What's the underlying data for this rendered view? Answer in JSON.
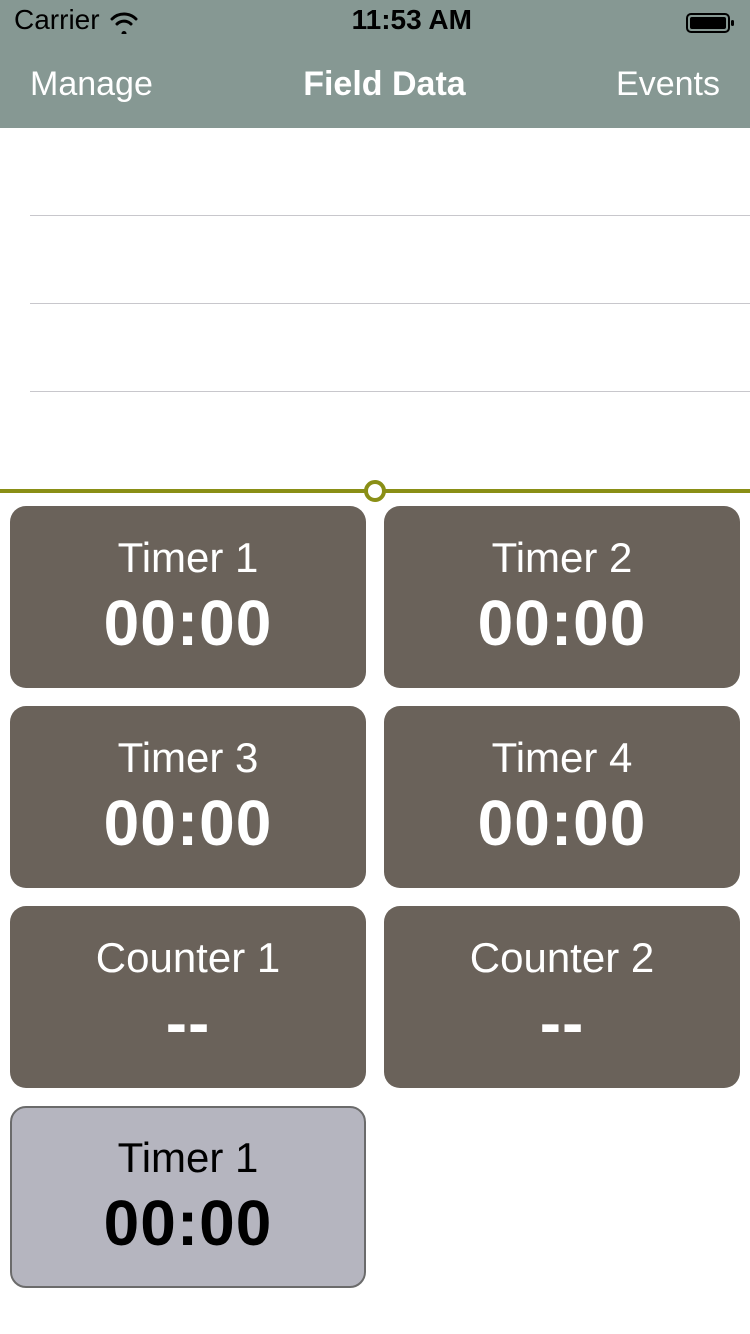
{
  "status_bar": {
    "carrier": "Carrier",
    "time": "11:53 AM"
  },
  "nav": {
    "left": "Manage",
    "title": "Field Data",
    "right": "Events"
  },
  "slider": {
    "position_percent": 50
  },
  "cards": [
    {
      "label": "Timer 1",
      "value": "00:00",
      "variant": "dark"
    },
    {
      "label": "Timer 2",
      "value": "00:00",
      "variant": "dark"
    },
    {
      "label": "Timer 3",
      "value": "00:00",
      "variant": "dark"
    },
    {
      "label": "Timer 4",
      "value": "00:00",
      "variant": "dark"
    },
    {
      "label": "Counter 1",
      "value": "--",
      "variant": "dark"
    },
    {
      "label": "Counter 2",
      "value": "--",
      "variant": "dark"
    },
    {
      "label": "Timer 1",
      "value": "00:00",
      "variant": "light"
    }
  ]
}
